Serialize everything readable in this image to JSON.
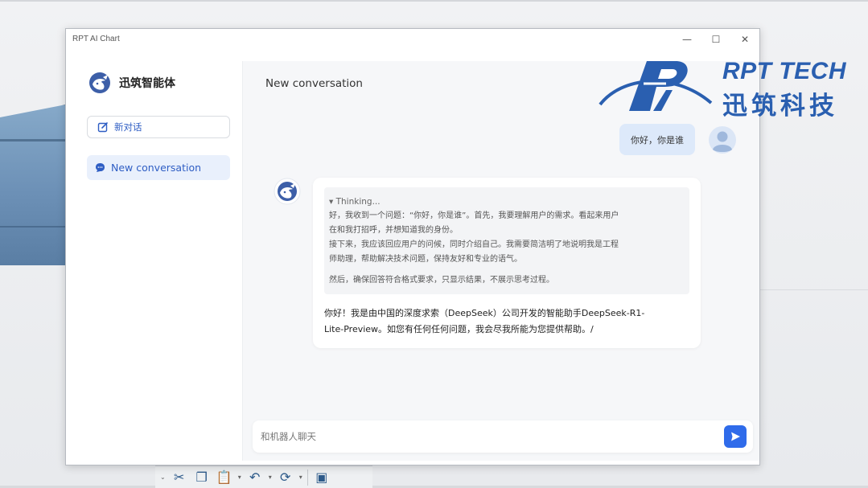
{
  "window": {
    "title": "RPT AI Chart",
    "controls": {
      "minimize": "—",
      "maximize": "☐",
      "close": "✕"
    }
  },
  "sidebar": {
    "brand_name": "迅筑智能体",
    "new_chat_label": "新对话",
    "conversations": [
      {
        "label": "New conversation"
      }
    ]
  },
  "main": {
    "header_title": "New conversation",
    "user_message": "你好，你是谁",
    "thinking": {
      "header": "▾ Thinking...",
      "lines": [
        "好，我收到一个问题：“你好，你是谁”。首先，我要理解用户的需求。看起来用户",
        "在和我打招呼，并想知道我的身份。",
        "接下来，我应该回应用户的问候，同时介绍自己。我需要简洁明了地说明我是工程",
        "师助理，帮助解决技术问题，保持友好和专业的语气。"
      ],
      "last_line": "然后，确保回答符合格式要求，只显示结果，不展示思考过程。"
    },
    "answer_lines": [
      "你好！我是由中国的深度求索（DeepSeek）公司开发的智能助手DeepSeek-R1-",
      "Lite-Preview。如您有任何任何问题，我会尽我所能为您提供帮助。/"
    ],
    "input_placeholder": "和机器人聊天",
    "colors": {
      "accent": "#2f6bea",
      "user_bubble": "#dde9fa",
      "selected_item": "#e9f0fc",
      "link": "#2f5ec4"
    }
  },
  "watermark": {
    "text_en": "RPT TECH",
    "text_cn": "迅筑科技"
  },
  "background_toolbar": {
    "icons": [
      "scissors-icon",
      "copy-icon",
      "paste-icon",
      "undo-icon",
      "redo-icon",
      "app-icon"
    ]
  }
}
